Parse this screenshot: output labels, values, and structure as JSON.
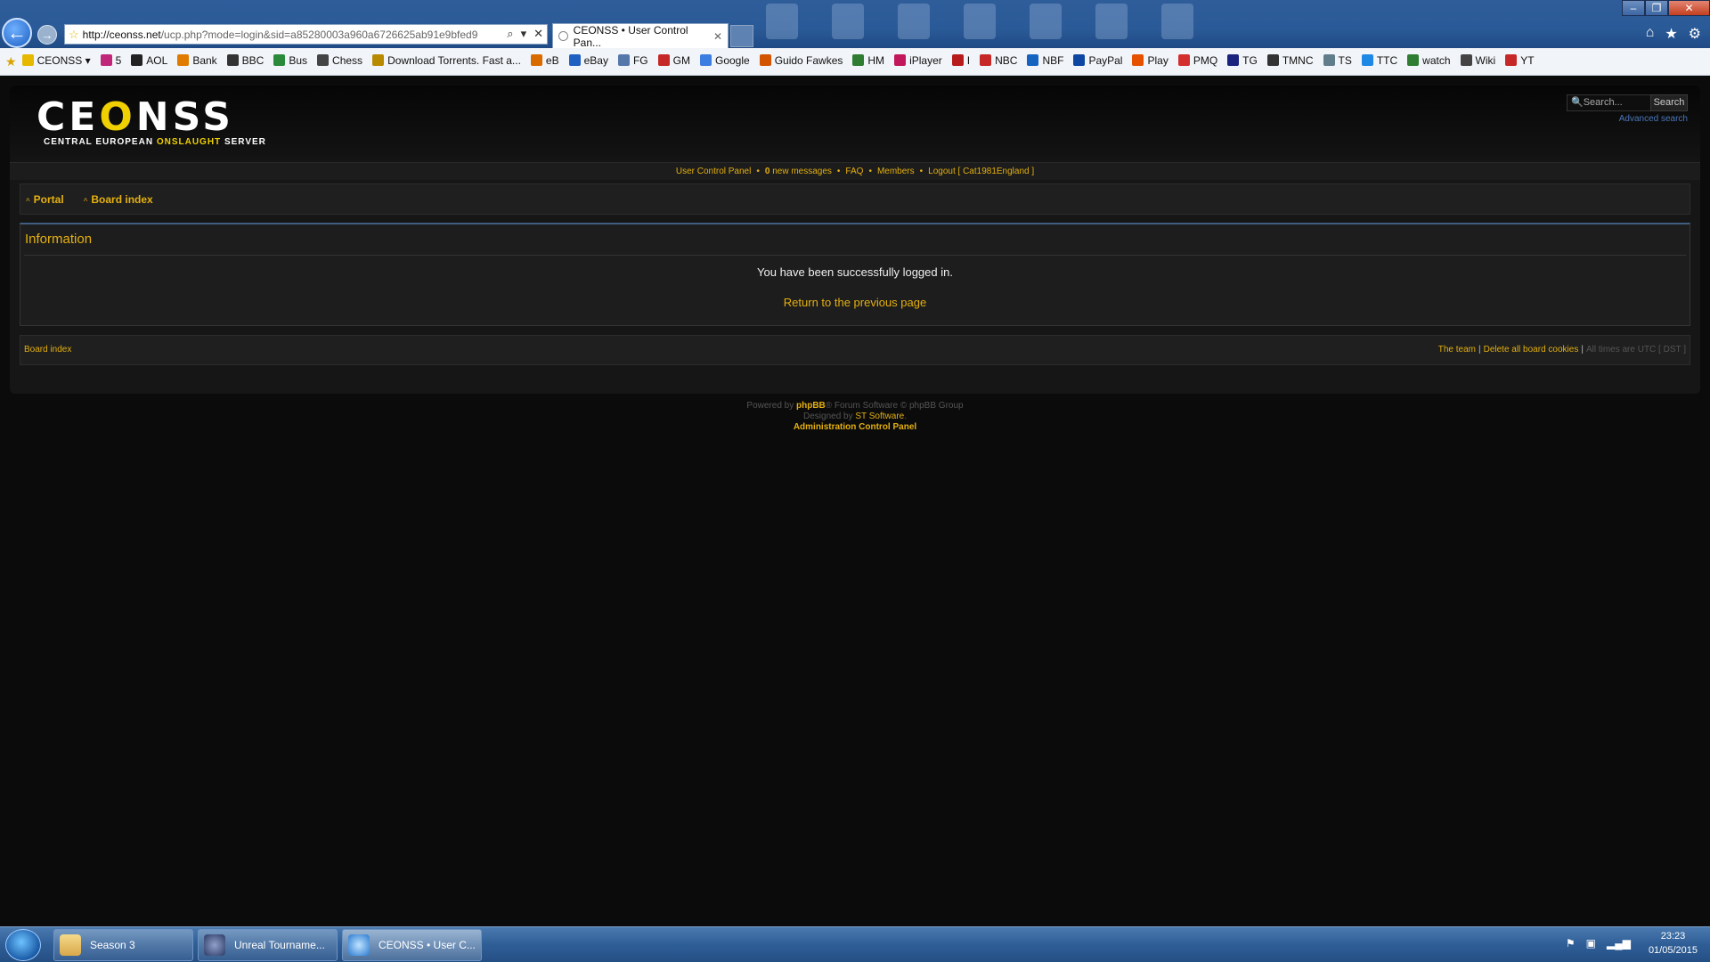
{
  "browser": {
    "url_host": "http://ceonss.net",
    "url_rest": "/ucp.php?mode=login&sid=a85280003a960a6726625ab91e9bfed9",
    "active_tab": "CEONSS • User Control Pan...",
    "favorites": [
      "CEONSS ▾",
      "5",
      "AOL",
      "Bank",
      "BBC",
      "Bus",
      "Chess",
      "Download Torrents. Fast a...",
      "eB",
      "eBay",
      "FG",
      "GM",
      "Google",
      "Guido Fawkes",
      "HM",
      "iPlayer",
      "I",
      "NBC",
      "NBF",
      "PayPal",
      "Play",
      "PMQ",
      "TG",
      "TMNC",
      "TS",
      "TTC",
      "watch",
      "Wiki",
      "YT"
    ]
  },
  "site": {
    "logo_text": "CEONSS",
    "logo_sub_a": "CENTRAL EUROPEAN ",
    "logo_sub_b": "ONSLAUGHT",
    "logo_sub_c": " SERVER",
    "search_placeholder": "Search...",
    "search_button": "Search",
    "advanced_search": "Advanced search"
  },
  "navbar": {
    "ucp": "User Control Panel",
    "msg_count": "0",
    "msg_label": " new messages",
    "faq": "FAQ",
    "members": "Members",
    "logout": "Logout [ Cat1981England ]"
  },
  "breadcrumbs": [
    "Portal",
    "Board index"
  ],
  "info": {
    "title": "Information",
    "message": "You have been successfully logged in.",
    "return_link": "Return to the previous page"
  },
  "footer": {
    "board_index": "Board index",
    "team": "The team",
    "delete_cookies": "Delete all board cookies",
    "timezone": "All times are UTC [ DST ]"
  },
  "credits": {
    "powered_by": "Powered by ",
    "phpbb": "phpBB",
    "forum_software": "® Forum Software © phpBB Group",
    "designed_by": "Designed by ",
    "st_software": "ST Software",
    "acp": "Administration Control Panel"
  },
  "taskbar": {
    "items": [
      "Season 3",
      "Unreal Tourname...",
      "CEONSS • User C..."
    ],
    "time": "23:23",
    "date": "01/05/2015"
  },
  "colors": {
    "accent": "#e4b010",
    "link_blue": "#4a76b8",
    "bg": "#0b0b0b"
  }
}
